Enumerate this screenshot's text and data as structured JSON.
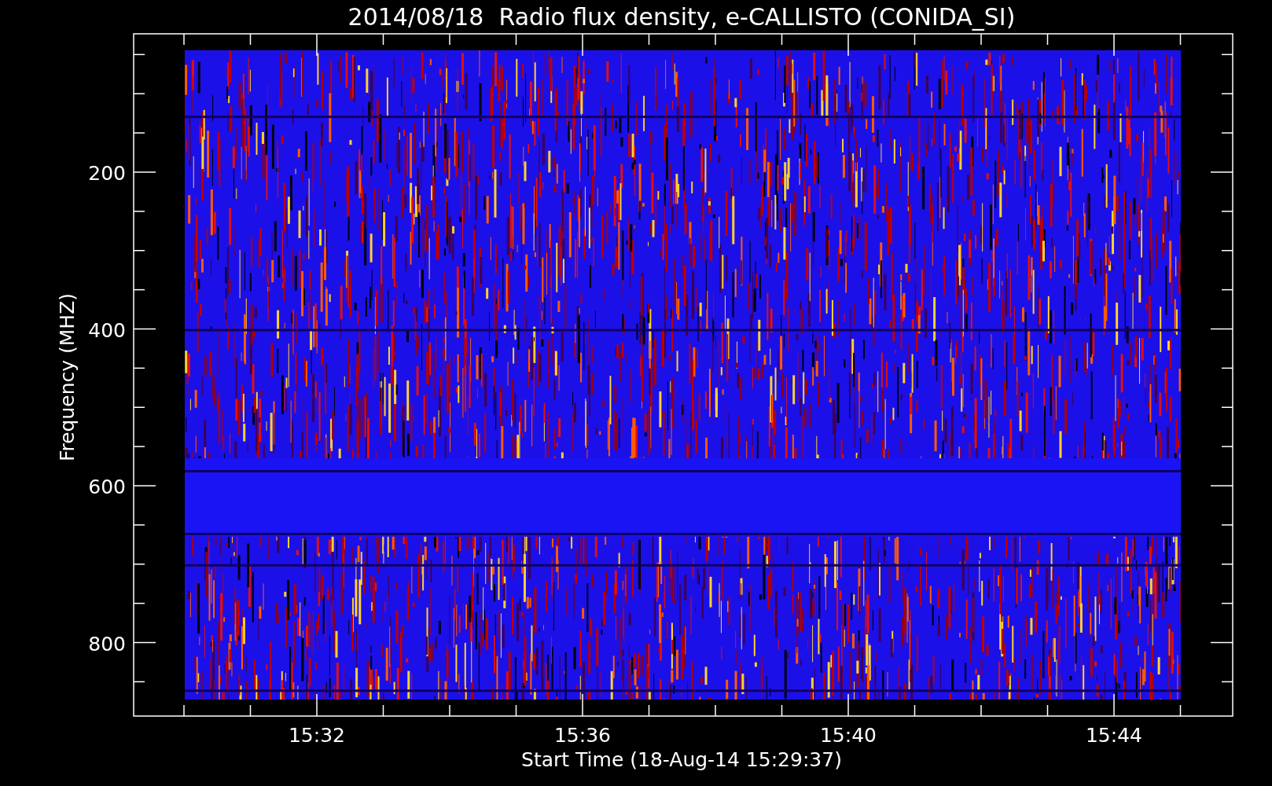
{
  "title": "2014/08/18  Radio flux density, e-CALLISTO (CONIDA_SI)",
  "y_axis": {
    "label": "Frequency (MHZ)",
    "ticks": [
      "200",
      "400",
      "600",
      "800"
    ]
  },
  "x_axis": {
    "label": "Start Time (18-Aug-14 15:29:37)",
    "ticks": [
      "15:32",
      "15:36",
      "15:40",
      "15:44"
    ]
  }
}
